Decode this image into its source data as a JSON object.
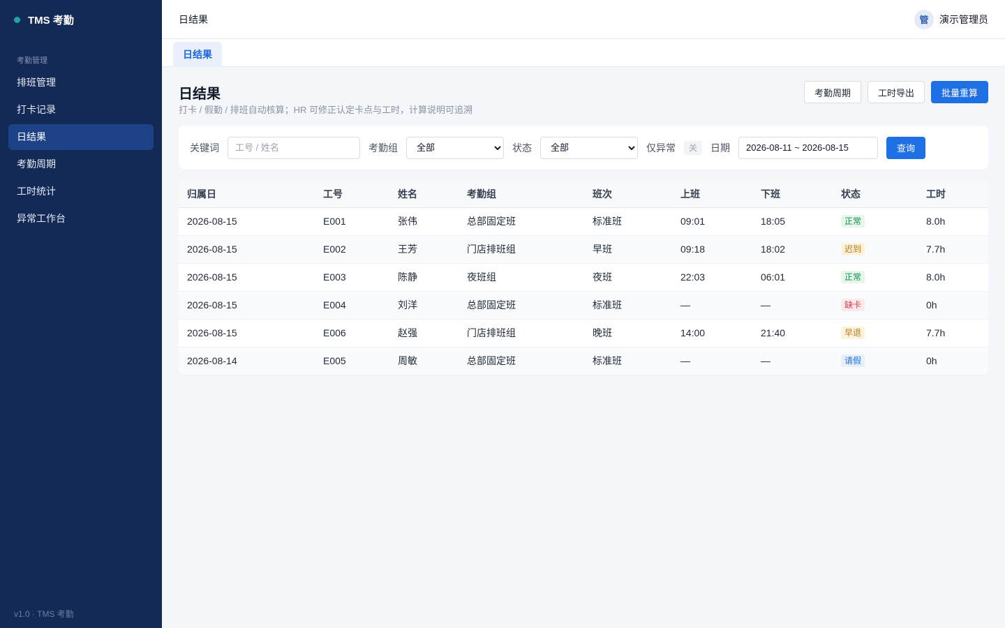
{
  "sidebar": {
    "brand": "TMS 考勤",
    "section": "考勤管理",
    "items": [
      "排班管理",
      "打卡记录",
      "日结果",
      "考勤周期",
      "工时统计",
      "异常工作台"
    ],
    "active_index": 2,
    "footer": "v1.0 · TMS 考勤"
  },
  "topbar": {
    "title": "日结果",
    "avatar": "管",
    "user": "演示管理员"
  },
  "tabs": [
    "日结果"
  ],
  "page": {
    "title": "日结果",
    "subtitle": "打卡 / 假勤 / 排班自动核算；HR 可修正认定卡点与工时，计算说明可追溯",
    "actions": {
      "cycle": "考勤周期",
      "export": "工时导出",
      "recalc": "批量重算"
    }
  },
  "filters": {
    "keyword_label": "关键词",
    "keyword_placeholder": "工号 / 姓名",
    "group_label": "考勤组",
    "group_value": "全部",
    "status_label": "状态",
    "status_value": "全部",
    "abnormal_label": "仅异常",
    "abnormal_toggle": "关",
    "date_label": "日期",
    "date_value": "2026-08-11 ~ 2026-08-15",
    "query": "查询"
  },
  "table": {
    "columns": [
      "归属日",
      "工号",
      "姓名",
      "考勤组",
      "班次",
      "上班",
      "下班",
      "状态",
      "工时"
    ],
    "rows": [
      [
        "2026-08-15",
        "E001",
        "张伟",
        "总部固定班",
        "标准班",
        "09:01",
        "18:05",
        "正常",
        "8.0h"
      ],
      [
        "2026-08-15",
        "E002",
        "王芳",
        "门店排班组",
        "早班",
        "09:18",
        "18:02",
        "迟到",
        "7.7h"
      ],
      [
        "2026-08-15",
        "E003",
        "陈静",
        "夜班组",
        "夜班",
        "22:03",
        "06:01",
        "正常",
        "8.0h"
      ],
      [
        "2026-08-15",
        "E004",
        "刘洋",
        "总部固定班",
        "标准班",
        "—",
        "—",
        "缺卡",
        "0h"
      ],
      [
        "2026-08-15",
        "E006",
        "赵强",
        "门店排班组",
        "晚班",
        "14:00",
        "21:40",
        "早退",
        "7.7h"
      ],
      [
        "2026-08-14",
        "E005",
        "周敏",
        "总部固定班",
        "标准班",
        "—",
        "—",
        "请假",
        "0h"
      ]
    ]
  },
  "status_colors": {
    "正常": {
      "bg": "#e6f6ec",
      "fg": "#1e8e4a"
    },
    "迟到": {
      "bg": "#fdf3dc",
      "fg": "#b7791f"
    },
    "缺卡": {
      "bg": "#fde8ea",
      "fg": "#d0384b"
    },
    "早退": {
      "bg": "#fdf3dc",
      "fg": "#b7791f"
    },
    "请假": {
      "bg": "#e6effc",
      "fg": "#2f6fd1"
    }
  }
}
